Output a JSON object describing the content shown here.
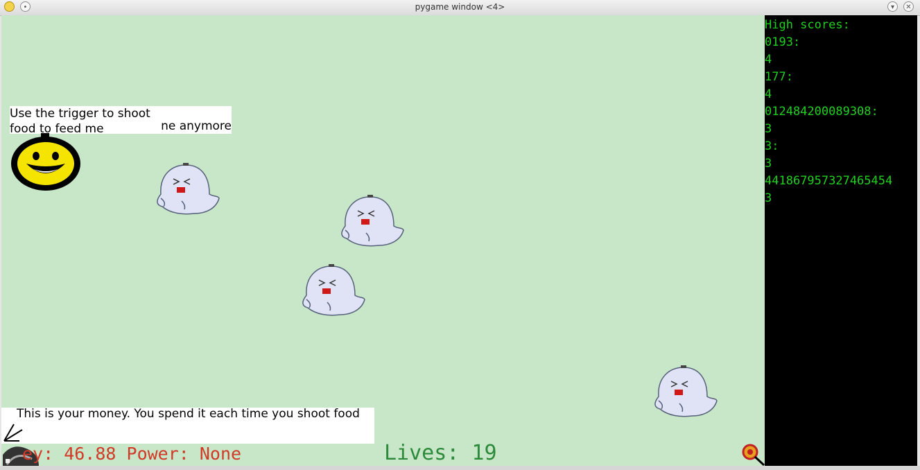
{
  "window": {
    "title": "pygame window <4>"
  },
  "high_scores": {
    "header": "High scores:",
    "lines": [
      "0193:",
      "4",
      "177:",
      "4",
      "012484200089308:",
      "3",
      "3:",
      "3",
      "441867957327465454",
      "3"
    ]
  },
  "bubbles": {
    "trigger_line1": "Use the trigger to shoot",
    "trigger_line2": "food to feed me",
    "trigger_fragment": "ne anymore",
    "money_hint": "This is your money. You spend it each time you shoot food"
  },
  "hud": {
    "money_power": "ey: 46.88  Power: None",
    "lives": "Lives: 19"
  },
  "colors": {
    "field": "#c8e6c8",
    "score_text": "#20d020",
    "money_text": "#d03a28",
    "lives_text": "#2d8a3a"
  },
  "sprites": {
    "mascot": "yellow-smiley-face",
    "enemy": "crying-ghost",
    "player": "bird-cannon",
    "cursor": "crosshair-target"
  }
}
